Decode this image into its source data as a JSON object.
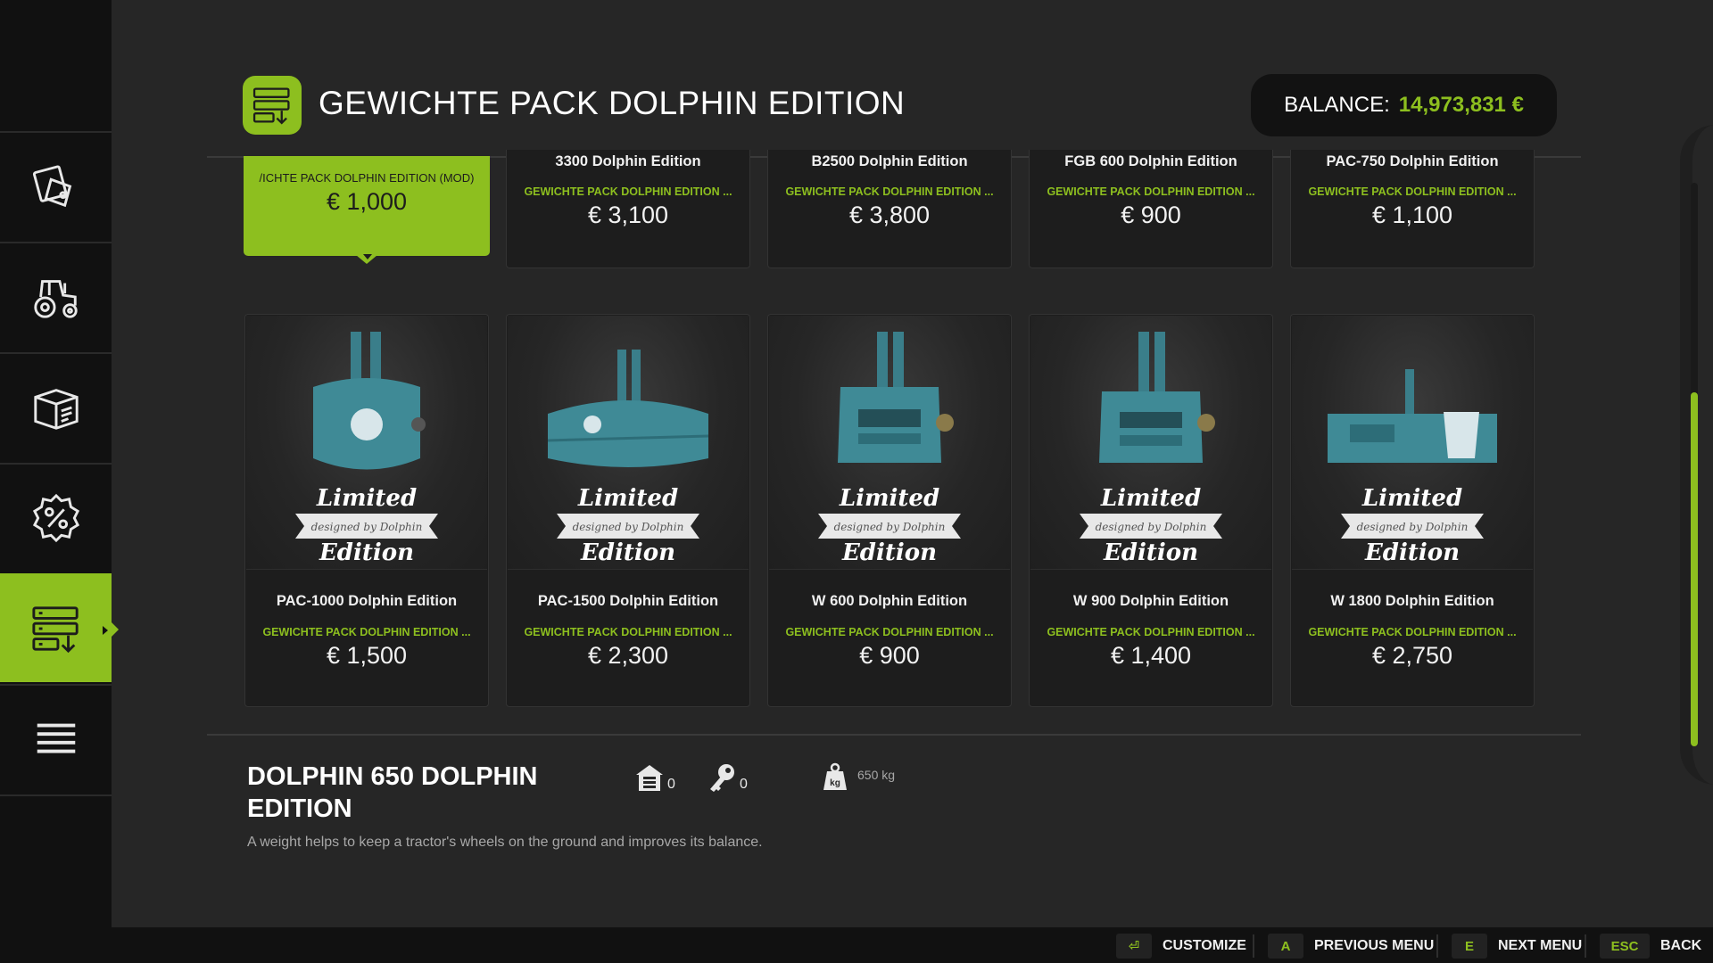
{
  "header": {
    "title": "GEWICHTE PACK DOLPHIN EDITION",
    "balance_label": "BALANCE:",
    "balance_value": "14,973,831 €"
  },
  "sidebar": {
    "items": [
      {
        "icon": "price-tag-icon",
        "active": false
      },
      {
        "icon": "tractor-icon",
        "active": false
      },
      {
        "icon": "box-icon",
        "active": false
      },
      {
        "icon": "percent-badge-icon",
        "active": false
      },
      {
        "icon": "pack-list-icon",
        "active": true
      },
      {
        "icon": "menu-list-icon",
        "active": false
      }
    ]
  },
  "selected_pack": {
    "label": "/ICHTE PACK DOLPHIN EDITION (MOD)",
    "price": "€ 1,000"
  },
  "top_row": [
    {
      "name": "3300 Dolphin Edition",
      "pack": "GEWICHTE PACK DOLPHIN EDITION ...",
      "price": "€ 3,100"
    },
    {
      "name": "B2500 Dolphin Edition",
      "pack": "GEWICHTE PACK DOLPHIN EDITION ...",
      "price": "€ 3,800"
    },
    {
      "name": "FGB 600 Dolphin Edition",
      "pack": "GEWICHTE PACK DOLPHIN EDITION ...",
      "price": "€ 900"
    },
    {
      "name": "PAC-750 Dolphin Edition",
      "pack": "GEWICHTE PACK DOLPHIN EDITION ...",
      "price": "€ 1,100"
    }
  ],
  "products": [
    {
      "name": "PAC-1000 Dolphin Edition",
      "pack": "GEWICHTE PACK DOLPHIN EDITION ...",
      "price": "€ 1,500"
    },
    {
      "name": "PAC-1500 Dolphin Edition",
      "pack": "GEWICHTE PACK DOLPHIN EDITION ...",
      "price": "€ 2,300"
    },
    {
      "name": "W 600 Dolphin Edition",
      "pack": "GEWICHTE PACK DOLPHIN EDITION ...",
      "price": "€ 900"
    },
    {
      "name": "W 900 Dolphin Edition",
      "pack": "GEWICHTE PACK DOLPHIN EDITION ...",
      "price": "€ 1,400"
    },
    {
      "name": "W 1800 Dolphin Edition",
      "pack": "GEWICHTE PACK DOLPHIN EDITION ...",
      "price": "€ 2,750"
    }
  ],
  "badge": {
    "line1": "Limited",
    "ribbon": "designed by Dolphin",
    "line2": "Edition"
  },
  "detail": {
    "title_line1": "DOLPHIN 650 DOLPHIN",
    "title_line2": "EDITION",
    "description": "A weight helps to keep a tractor's wheels on the ground and improves its balance.",
    "owned_count": "0",
    "leased_count": "0",
    "weight": "650 kg"
  },
  "footer": {
    "customize_key": "⏎",
    "customize_label": "CUSTOMIZE",
    "prev_key": "A",
    "prev_label": "PREVIOUS MENU",
    "next_key": "E",
    "next_label": "NEXT MENU",
    "back_key": "ESC",
    "back_label": "BACK"
  },
  "colors": {
    "accent": "#8dbf1f",
    "background": "#262626",
    "sidebar": "#111111",
    "weight_teal": "#3f8a96"
  }
}
